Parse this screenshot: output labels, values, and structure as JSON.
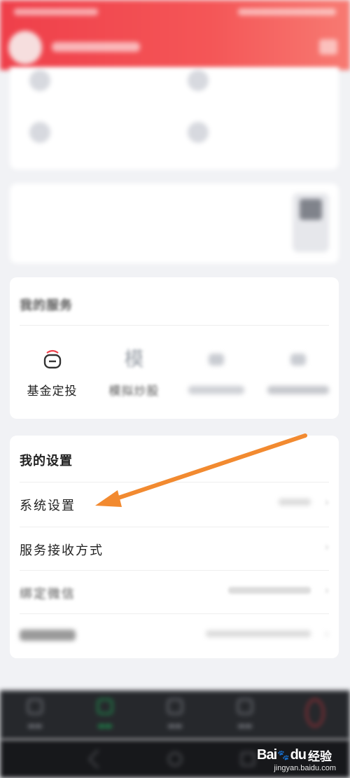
{
  "colors": {
    "accent": "#ef3f4a",
    "arrow": "#f28a30",
    "nav_active": "#1ba655"
  },
  "header": {
    "icons": [
      "avatar",
      "message-icon"
    ]
  },
  "top_grid": {
    "items": [
      {
        "icon": "fund-icon"
      },
      {
        "icon": "fund-icon"
      },
      {
        "icon": "fund-icon"
      },
      {
        "icon": "fund-icon"
      }
    ]
  },
  "services": {
    "title": "我的服务",
    "items": [
      {
        "icon": "wallet-icon",
        "label": "基金定投"
      },
      {
        "icon": "mo-icon",
        "glyph": "模",
        "label": "模拟炒股"
      },
      {
        "icon": "box-icon",
        "label": ""
      },
      {
        "icon": "box-icon",
        "label": ""
      }
    ]
  },
  "settings": {
    "title": "我的设置",
    "rows": [
      {
        "label": "系统设置"
      },
      {
        "label": "服务接收方式"
      },
      {
        "label": "绑定微信"
      },
      {
        "label": ""
      }
    ]
  },
  "bottom_nav": {
    "items": [
      {
        "icon": "home-icon"
      },
      {
        "icon": "market-icon"
      },
      {
        "icon": "trade-icon"
      },
      {
        "icon": "info-icon"
      },
      {
        "icon": "profile-icon"
      }
    ]
  },
  "watermark": {
    "brand": "Bai",
    "brand2": "du",
    "jingyan": "经验",
    "url": "jingyan.baidu.com"
  }
}
